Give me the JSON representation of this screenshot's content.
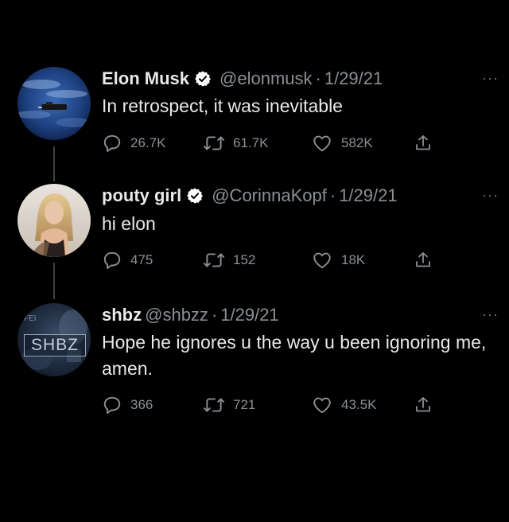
{
  "tweets": [
    {
      "name": "Elon Musk",
      "handle": "@elonmusk",
      "separator": "·",
      "date": "1/29/21",
      "text": "In retrospect, it was inevitable",
      "replies": "26.7K",
      "retweets": "61.7K",
      "likes": "582K",
      "verified": true
    },
    {
      "name": "pouty girl",
      "handle": "@CorinnaKopf",
      "separator": "·",
      "date": "1/29/21",
      "text": "hi elon",
      "replies": "475",
      "retweets": "152",
      "likes": "18K",
      "verified": true
    },
    {
      "name": "shbz",
      "handle": "@shbzz",
      "separator": "·",
      "date": "1/29/21",
      "text": "Hope he ignores u the way u been ignoring me, amen.",
      "replies": "366",
      "retweets": "721",
      "likes": "43.5K",
      "verified": false,
      "avatar_text": "SHBZ"
    }
  ],
  "more_label": "···",
  "icons": {
    "reply": "reply-icon",
    "retweet": "retweet-icon",
    "like": "like-icon",
    "share": "share-icon",
    "verified": "verified-badge-icon"
  },
  "colors": {
    "background": "#000000",
    "text": "#e7e9ea",
    "muted": "#8b8f94",
    "verified_badge": "#ffffff"
  }
}
